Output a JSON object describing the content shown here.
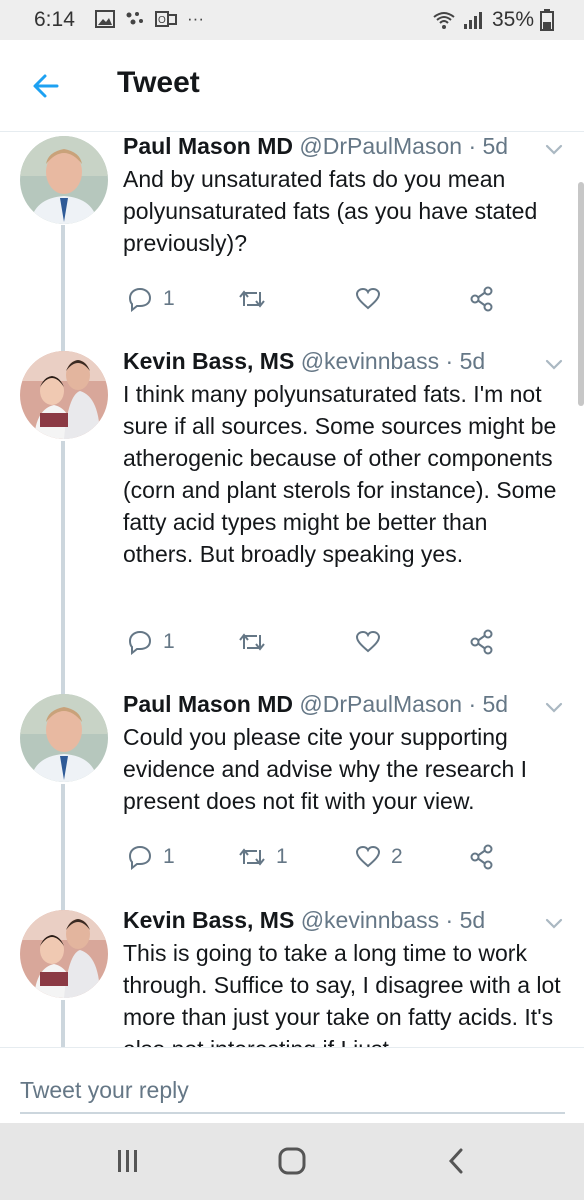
{
  "status_bar": {
    "time": "6:14",
    "battery": "35%",
    "icons": [
      "image-icon",
      "dots-icon",
      "outlook-icon",
      "more-icon",
      "wifi-icon",
      "signal-icon",
      "battery-icon"
    ]
  },
  "header": {
    "title": "Tweet",
    "back_icon": "arrow-left-icon",
    "accent_color": "#1da1f2"
  },
  "tweets": [
    {
      "name": "Paul Mason MD",
      "handle": "@DrPaulMason",
      "time": "5d",
      "text": "And by unsaturated fats do you mean polyunsaturated fats (as you have stated previously)?",
      "replies": "1",
      "retweets": "",
      "likes": ""
    },
    {
      "name": "Kevin Bass, MS",
      "handle": "@kevinnbass",
      "time": "5d",
      "text": "I think many polyunsaturated fats. I'm not sure if all sources. Some sources might be atherogenic because of other components (corn and plant sterols for instance). Some fatty acid types might be better than others. But broadly speaking yes.",
      "replies": "1",
      "retweets": "",
      "likes": ""
    },
    {
      "name": "Paul Mason MD",
      "handle": "@DrPaulMason",
      "time": "5d",
      "text": "Could you please cite your supporting evidence and advise why the research I present does not fit with your view.",
      "replies": "1",
      "retweets": "1",
      "likes": "2"
    },
    {
      "name": "Kevin Bass, MS",
      "handle": "@kevinnbass",
      "time": "5d",
      "text": "This is going to take a long time to work through. Suffice to say, I disagree with a lot more than just your take on fatty acids. It's also not interesting if I just"
    }
  ],
  "tweet_separator": "·",
  "reply": {
    "placeholder": "Tweet your reply"
  },
  "colors": {
    "text": "#14171a",
    "secondary": "#657786",
    "thread_line": "#ccd6dd"
  }
}
